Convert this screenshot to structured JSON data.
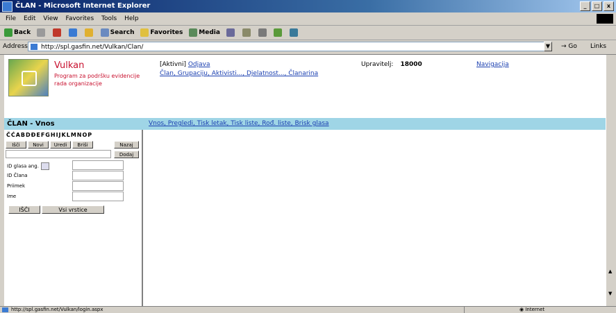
{
  "window": {
    "title": "ČLAN - Microsoft Internet Explorer",
    "buttons": [
      "_",
      "□",
      "x"
    ]
  },
  "menubar": [
    "File",
    "Edit",
    "View",
    "Favorites",
    "Tools",
    "Help"
  ],
  "toolbar": {
    "back": "Back",
    "search": "Search",
    "favorites": "Favorites",
    "media": "Media"
  },
  "address": {
    "label": "Address",
    "url": "http://spl.gasfin.net/Vulkan/Clan/",
    "go": "Go",
    "links": "Links"
  },
  "header": {
    "app_name": "Vulkan",
    "app_subtitle": "Program za podršku evidencije rada organizacije",
    "account_prefix": "[Aktivni]",
    "account_link": "Odjava",
    "nav_links": "Član, Grupaciju, Aktivisti..., Djelatnost..., Članarina",
    "user_label": "Upravitelj:",
    "user_value": "18000",
    "help_link": "Navigacija"
  },
  "section": {
    "title": "ČLAN - Vnos",
    "nav_links": "Vnos, Pregledi, Tisk letak, Tisk liste, Rođ. liste, Brisk glasa"
  },
  "leftpanel": {
    "letters": "ČĆABDĐEFGHIJKLMNOP",
    "buttons": [
      "Išči",
      "Novi",
      "Uredi",
      "Briši",
      "Nazaj",
      "Dodaj"
    ],
    "fields": [
      {
        "label": "ID glasa ang."
      },
      {
        "label": "ID Člana"
      },
      {
        "label": "Priimek"
      },
      {
        "label": "Ime"
      }
    ],
    "action_search": "IŠČI",
    "action_all": "Vsi vrstice"
  },
  "statusbar": {
    "url": "http://spl.gasfin.net/Vulkan/login.aspx",
    "zone": "Internet"
  },
  "colors": {
    "titlebar": "#0a246a",
    "strip": "#9fd5e6",
    "brand_red": "#c8102e",
    "link_blue": "#1a3fb0"
  }
}
